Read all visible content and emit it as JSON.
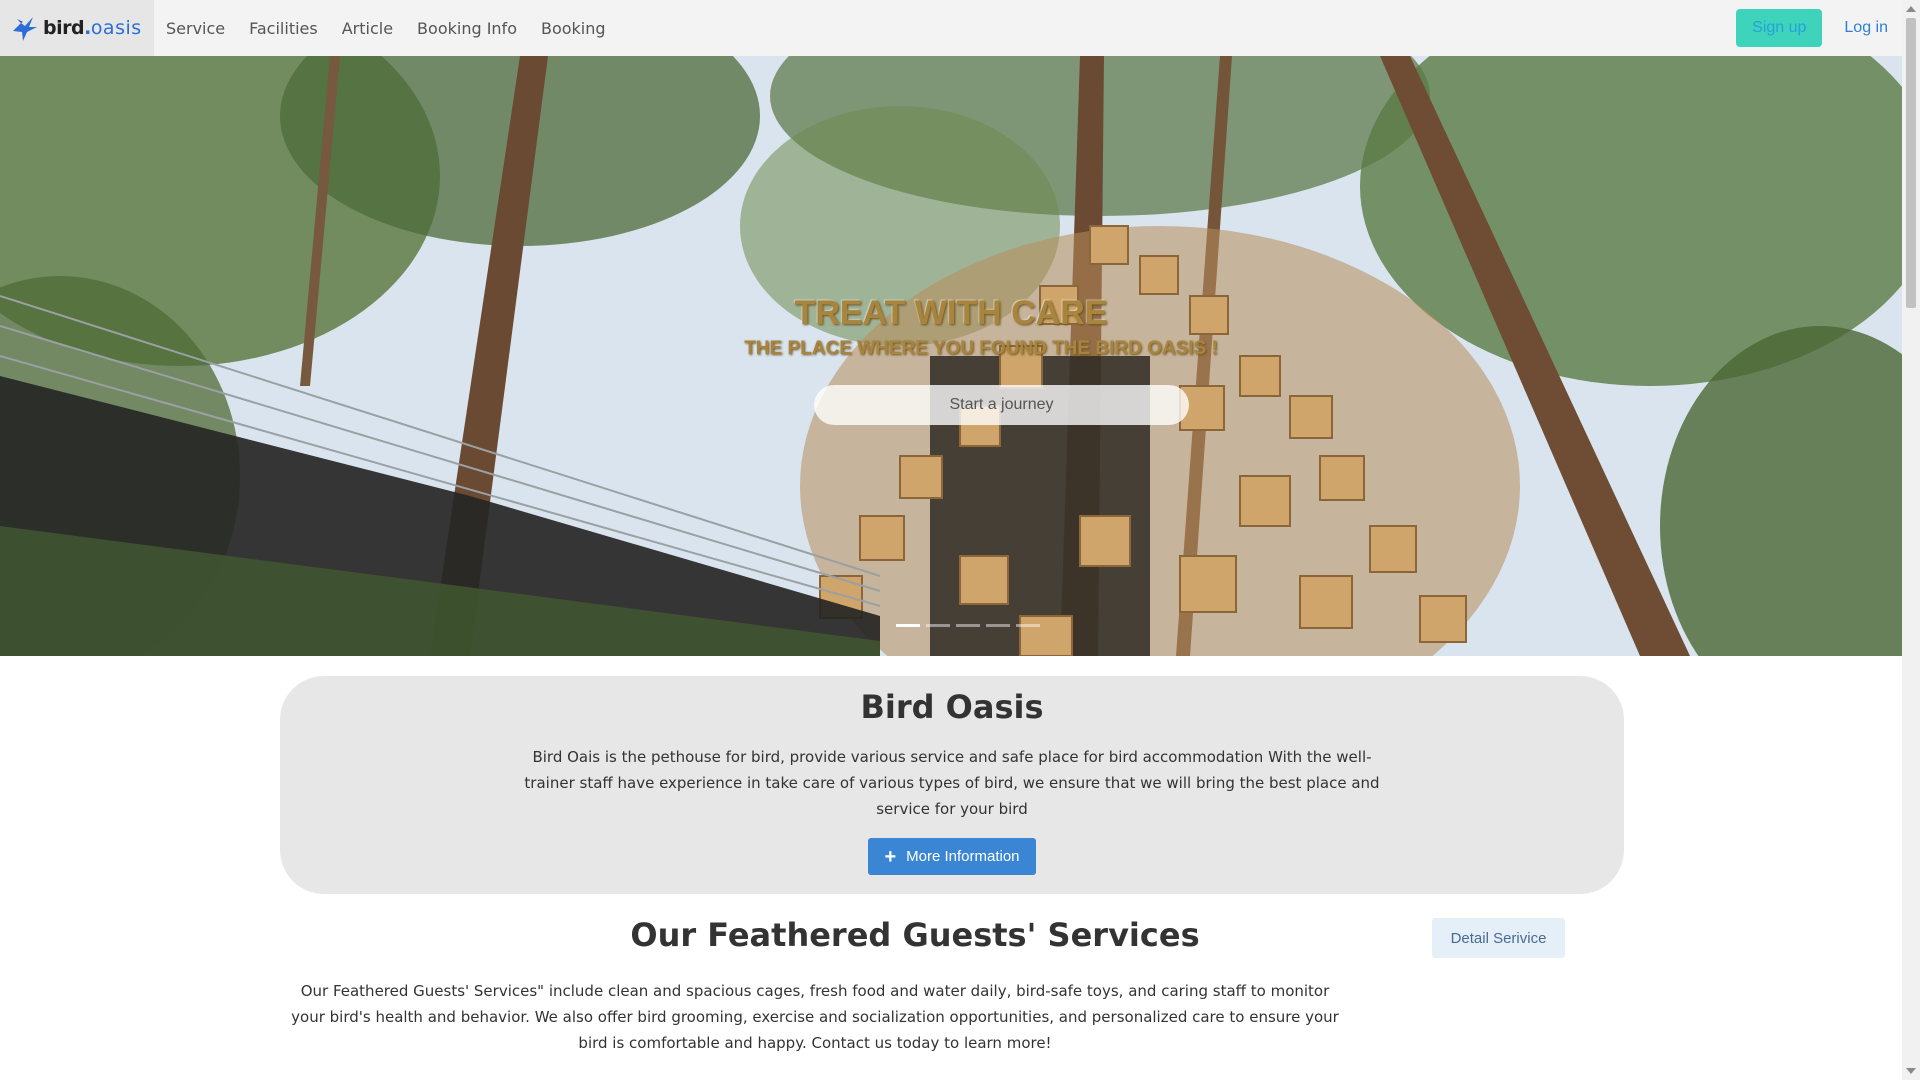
{
  "nav": {
    "brand_prefix": "bird",
    "brand_dot": ".",
    "brand_suffix": "oasis",
    "links": [
      "Service",
      "Facilities",
      "Article",
      "Booking Info",
      "Booking"
    ],
    "signup_label": "Sign up",
    "login_label": "Log in"
  },
  "hero": {
    "title": "TREAT WITH CARE",
    "subtitle": "THE PLACE WHERE YOU FOUND THE BIRD OASIS !",
    "cta_label": "Start a journey",
    "slide_count": 5,
    "active_slide": 1
  },
  "about": {
    "title": "Bird Oasis",
    "text": "Bird Oais is the pethouse for bird, provide various service and safe place for bird accommodation With the well-trainer staff have experience in take care of various types of bird, we ensure that we will bring the best place and service for your bird",
    "button_icon": "+",
    "button_label": "More Information"
  },
  "services": {
    "title": "Our Feathered Guests' Services",
    "detail_button": "Detail Serivice",
    "text": "Our Feathered Guests' Services\" include clean and spacious cages, fresh food and water daily, bird-safe toys, and caring staff to monitor your bird's health and behavior. We also offer bird grooming, exercise and socialization opportunities, and personalized care to ensure your bird is comfortable and happy. Contact us today to learn more!"
  },
  "colors": {
    "signup_bg": "#3ed3bb",
    "link_blue": "#2d7fd6",
    "primary_button": "#3a86d4",
    "card_bg": "#e7e7e7",
    "hero_text": "#a8843c"
  }
}
